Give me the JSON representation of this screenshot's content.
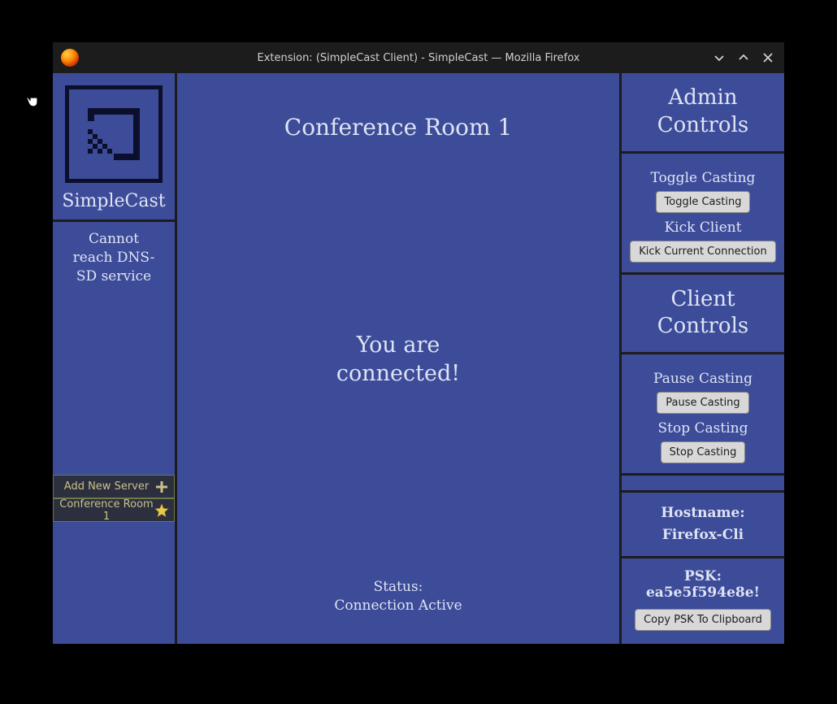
{
  "window": {
    "title": "Extension: (SimpleCast Client) - SimpleCast — Mozilla Firefox"
  },
  "sidebar": {
    "app_name": "SimpleCast",
    "status_message": "Cannot reach DNS-SD service",
    "add_server_label": "Add New Server",
    "servers": [
      {
        "label": "Conference Room 1",
        "favorite": true
      }
    ]
  },
  "main": {
    "room_title": "Conference Room 1",
    "connected_message": "You are connected!",
    "status_label": "Status:",
    "status_value": "Connection Active"
  },
  "right": {
    "admin_header": "Admin Controls",
    "toggle_casting_label": "Toggle Casting",
    "toggle_casting_button": "Toggle Casting",
    "kick_client_label": "Kick Client",
    "kick_client_button": "Kick Current Connection",
    "client_header": "Client Controls",
    "pause_casting_label": "Pause Casting",
    "pause_casting_button": "Pause Casting",
    "stop_casting_label": "Stop Casting",
    "stop_casting_button": "Stop Casting",
    "hostname_label": "Hostname:",
    "hostname_value": "Firefox-Cli",
    "psk_label": "PSK: ea5e5f594e8e!",
    "copy_psk_button": "Copy PSK To Clipboard"
  }
}
